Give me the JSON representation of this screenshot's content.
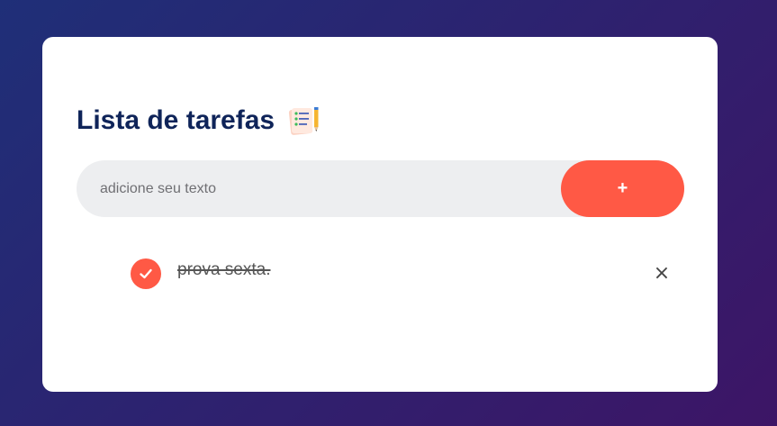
{
  "app": {
    "title": "Lista de tarefas",
    "title_icon": "notepad-pencil-icon"
  },
  "input": {
    "placeholder": "adicione seu texto",
    "value": ""
  },
  "add_button": {
    "label": "+"
  },
  "tasks": [
    {
      "text": "prova sexta.",
      "checked": true,
      "check_icon": "check-icon",
      "delete_label": "×",
      "delete_icon": "close-icon"
    }
  ],
  "colors": {
    "accent": "#ff5945",
    "title": "#0f2459",
    "input_background": "#edeef0",
    "background_start": "#1f2f78",
    "background_end": "#3d1566"
  }
}
